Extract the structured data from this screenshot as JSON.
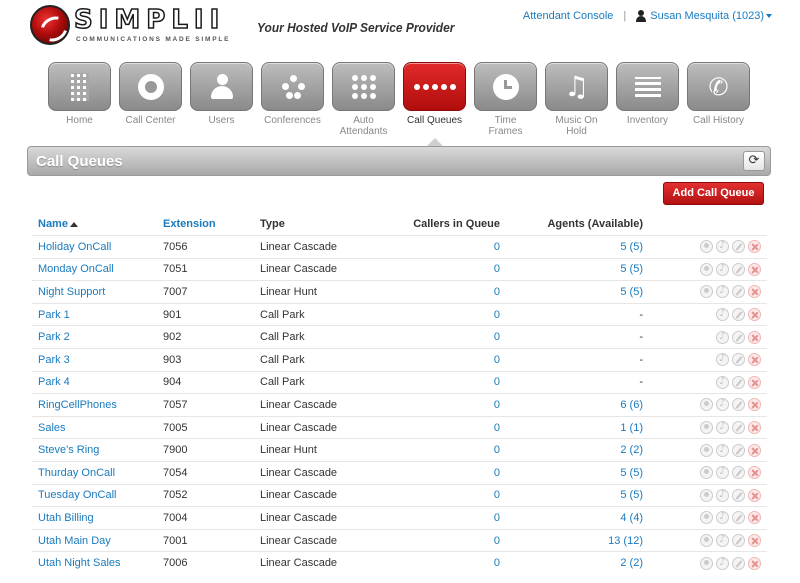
{
  "brand": {
    "logo_word": "SIMPLII",
    "logo_tagline": "COMMUNICATIONS MADE SIMPLE",
    "tagline": "Your Hosted VoIP Service Provider"
  },
  "topbar": {
    "attendant_console": "Attendant Console",
    "separator": "|",
    "user": "Susan Mesquita (1023)"
  },
  "nav": [
    {
      "key": "home",
      "label": "Home",
      "icon": "building-icon"
    },
    {
      "key": "call-center",
      "label": "Call Center",
      "icon": "headset-icon"
    },
    {
      "key": "users",
      "label": "Users",
      "icon": "user-icon"
    },
    {
      "key": "conferences",
      "label": "Conferences",
      "icon": "conference-icon"
    },
    {
      "key": "auto-attendants",
      "label": "Auto\nAttendants",
      "icon": "keypad-icon"
    },
    {
      "key": "call-queues",
      "label": "Call Queues",
      "icon": "queue-dots-icon",
      "active": true
    },
    {
      "key": "time-frames",
      "label": "Time\nFrames",
      "icon": "clock-icon"
    },
    {
      "key": "music-on-hold",
      "label": "Music On\nHold",
      "icon": "music-note-icon"
    },
    {
      "key": "inventory",
      "label": "Inventory",
      "icon": "list-icon"
    },
    {
      "key": "call-history",
      "label": "Call History",
      "icon": "phone-history-icon"
    }
  ],
  "section": {
    "title": "Call Queues",
    "refresh_icon": "refresh-icon",
    "add_button": "Add Call Queue"
  },
  "table": {
    "headers": {
      "name": "Name",
      "extension": "Extension",
      "type": "Type",
      "callers": "Callers in Queue",
      "agents": "Agents (Available)"
    },
    "rows": [
      {
        "name": "Holiday OnCall",
        "ext": "7056",
        "type": "Linear Cascade",
        "callers": "0",
        "agents": "5 (5)",
        "agent_link": true
      },
      {
        "name": "Monday OnCall",
        "ext": "7051",
        "type": "Linear Cascade",
        "callers": "0",
        "agents": "5 (5)",
        "agent_link": true
      },
      {
        "name": "Night Support",
        "ext": "7007",
        "type": "Linear Hunt",
        "callers": "0",
        "agents": "5 (5)",
        "agent_link": true
      },
      {
        "name": "Park 1",
        "ext": "901",
        "type": "Call Park",
        "callers": "0",
        "agents": "-",
        "agent_link": false
      },
      {
        "name": "Park 2",
        "ext": "902",
        "type": "Call Park",
        "callers": "0",
        "agents": "-",
        "agent_link": false
      },
      {
        "name": "Park 3",
        "ext": "903",
        "type": "Call Park",
        "callers": "0",
        "agents": "-",
        "agent_link": false
      },
      {
        "name": "Park 4",
        "ext": "904",
        "type": "Call Park",
        "callers": "0",
        "agents": "-",
        "agent_link": false
      },
      {
        "name": "RingCellPhones",
        "ext": "7057",
        "type": "Linear Cascade",
        "callers": "0",
        "agents": "6 (6)",
        "agent_link": true
      },
      {
        "name": "Sales",
        "ext": "7005",
        "type": "Linear Cascade",
        "callers": "0",
        "agents": "1 (1)",
        "agent_link": true
      },
      {
        "name": "Steve's Ring",
        "ext": "7900",
        "type": "Linear Hunt",
        "callers": "0",
        "agents": "2 (2)",
        "agent_link": true
      },
      {
        "name": "Thurday OnCall",
        "ext": "7054",
        "type": "Linear Cascade",
        "callers": "0",
        "agents": "5 (5)",
        "agent_link": true
      },
      {
        "name": "Tuesday OnCall",
        "ext": "7052",
        "type": "Linear Cascade",
        "callers": "0",
        "agents": "5 (5)",
        "agent_link": true
      },
      {
        "name": "Utah Billing",
        "ext": "7004",
        "type": "Linear Cascade",
        "callers": "0",
        "agents": "4 (4)",
        "agent_link": true
      },
      {
        "name": "Utah Main Day",
        "ext": "7001",
        "type": "Linear Cascade",
        "callers": "0",
        "agents": "13 (12)",
        "agent_link": true
      },
      {
        "name": "Utah Night Sales",
        "ext": "7006",
        "type": "Linear Cascade",
        "callers": "0",
        "agents": "2 (2)",
        "agent_link": true
      }
    ]
  },
  "colors": {
    "accent_link": "#1a7bbf",
    "active_tile": "#c81818",
    "add_button": "#c41a1a"
  }
}
